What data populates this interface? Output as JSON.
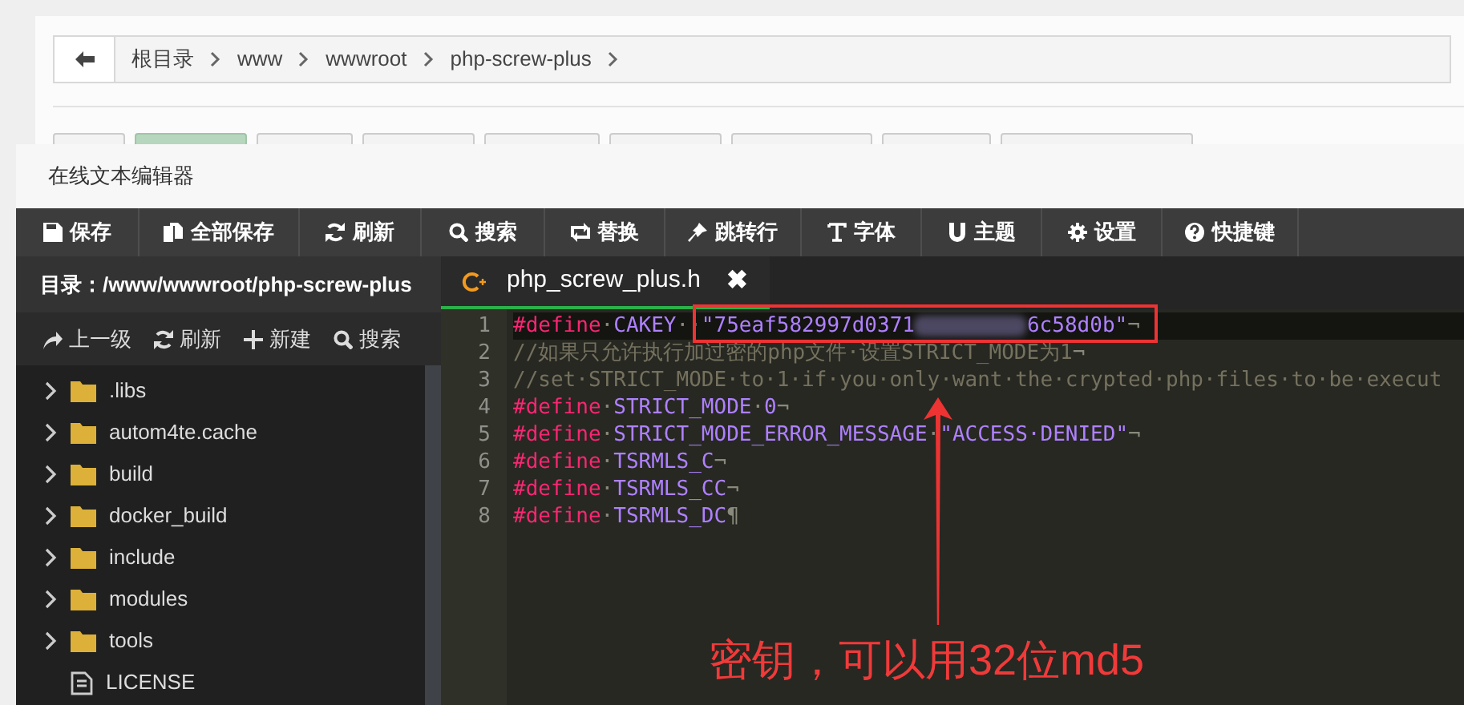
{
  "breadcrumb": {
    "items": [
      "根目录",
      "www",
      "wwwroot",
      "php-screw-plus"
    ]
  },
  "hidden_buttons": [
    {
      "selected": false
    },
    {
      "selected": true
    },
    {
      "selected": false
    },
    {
      "selected": false
    },
    {
      "selected": false
    },
    {
      "selected": false
    },
    {
      "selected": false
    },
    {
      "selected": false
    },
    {
      "selected": false
    }
  ],
  "window": {
    "title": "在线文本编辑器"
  },
  "toolbar": [
    "保存",
    "全部保存",
    "刷新",
    "搜索",
    "替换",
    "跳转行",
    "字体",
    "主题",
    "设置",
    "快捷键"
  ],
  "sidebar": {
    "path": "目录：/www/wwwroot/php-screw-plus",
    "actions": [
      "上一级",
      "刷新",
      "新建",
      "搜索"
    ],
    "items": [
      {
        "name": ".libs",
        "kind": "folder",
        "expanded": false
      },
      {
        "name": "autom4te.cache",
        "kind": "folder",
        "expanded": false
      },
      {
        "name": "build",
        "kind": "folder",
        "expanded": false
      },
      {
        "name": "docker_build",
        "kind": "folder",
        "expanded": false
      },
      {
        "name": "include",
        "kind": "folder",
        "expanded": false
      },
      {
        "name": "modules",
        "kind": "folder",
        "expanded": false
      },
      {
        "name": "tools",
        "kind": "folder",
        "expanded": false
      },
      {
        "name": "LICENSE",
        "kind": "file"
      }
    ]
  },
  "tabs": [
    {
      "label": "php_screw_plus.h",
      "close": "✖",
      "selected": true
    }
  ],
  "editor": {
    "lines": [
      {
        "number": "1",
        "active": true,
        "tokens": [
          {
            "kind": "keyword",
            "text": "#define"
          },
          {
            "kind": "space",
            "text": "·"
          },
          {
            "kind": "name",
            "text": "CAKEY"
          },
          {
            "kind": "space",
            "text": "··"
          },
          {
            "kind": "string",
            "text": "\"75eaf582997d0371"
          },
          {
            "kind": "blur"
          },
          {
            "kind": "string",
            "text": "6c58d0b\""
          },
          {
            "kind": "space",
            "text": "¬"
          }
        ]
      },
      {
        "number": "2",
        "active": false,
        "tokens": [
          {
            "kind": "comment",
            "text": "//如果只允许执行加过密的php文件·设置STRICT_MODE为1"
          },
          {
            "kind": "space",
            "text": "¬"
          }
        ]
      },
      {
        "number": "3",
        "active": false,
        "tokens": [
          {
            "kind": "comment",
            "text": "//set·STRICT_MODE·to·1·if·you·only·want·the·crypted·php·files·to·be·execut"
          }
        ]
      },
      {
        "number": "4",
        "active": false,
        "tokens": [
          {
            "kind": "keyword",
            "text": "#define"
          },
          {
            "kind": "space",
            "text": "·"
          },
          {
            "kind": "name",
            "text": "STRICT_MODE"
          },
          {
            "kind": "space",
            "text": "·"
          },
          {
            "kind": "name",
            "text": "0"
          },
          {
            "kind": "space",
            "text": "¬"
          }
        ]
      },
      {
        "number": "5",
        "active": false,
        "tokens": [
          {
            "kind": "keyword",
            "text": "#define"
          },
          {
            "kind": "space",
            "text": "·"
          },
          {
            "kind": "name",
            "text": "STRICT_MODE_ERROR_MESSAGE"
          },
          {
            "kind": "space",
            "text": "·"
          },
          {
            "kind": "string",
            "text": "\"ACCESS·DENIED\""
          },
          {
            "kind": "space",
            "text": "¬"
          }
        ]
      },
      {
        "number": "6",
        "active": false,
        "tokens": [
          {
            "kind": "keyword",
            "text": "#define"
          },
          {
            "kind": "space",
            "text": "·"
          },
          {
            "kind": "name",
            "text": "TSRMLS_C"
          },
          {
            "kind": "space",
            "text": "¬"
          }
        ]
      },
      {
        "number": "7",
        "active": false,
        "tokens": [
          {
            "kind": "keyword",
            "text": "#define"
          },
          {
            "kind": "space",
            "text": "·"
          },
          {
            "kind": "name",
            "text": "TSRMLS_CC"
          },
          {
            "kind": "space",
            "text": "¬"
          }
        ]
      },
      {
        "number": "8",
        "active": false,
        "tokens": [
          {
            "kind": "keyword",
            "text": "#define"
          },
          {
            "kind": "space",
            "text": "·"
          },
          {
            "kind": "name",
            "text": "TSRMLS_DC"
          },
          {
            "kind": "space",
            "text": "¶"
          }
        ]
      }
    ]
  },
  "annotation": {
    "text": "密钥，可以用32位md5"
  }
}
